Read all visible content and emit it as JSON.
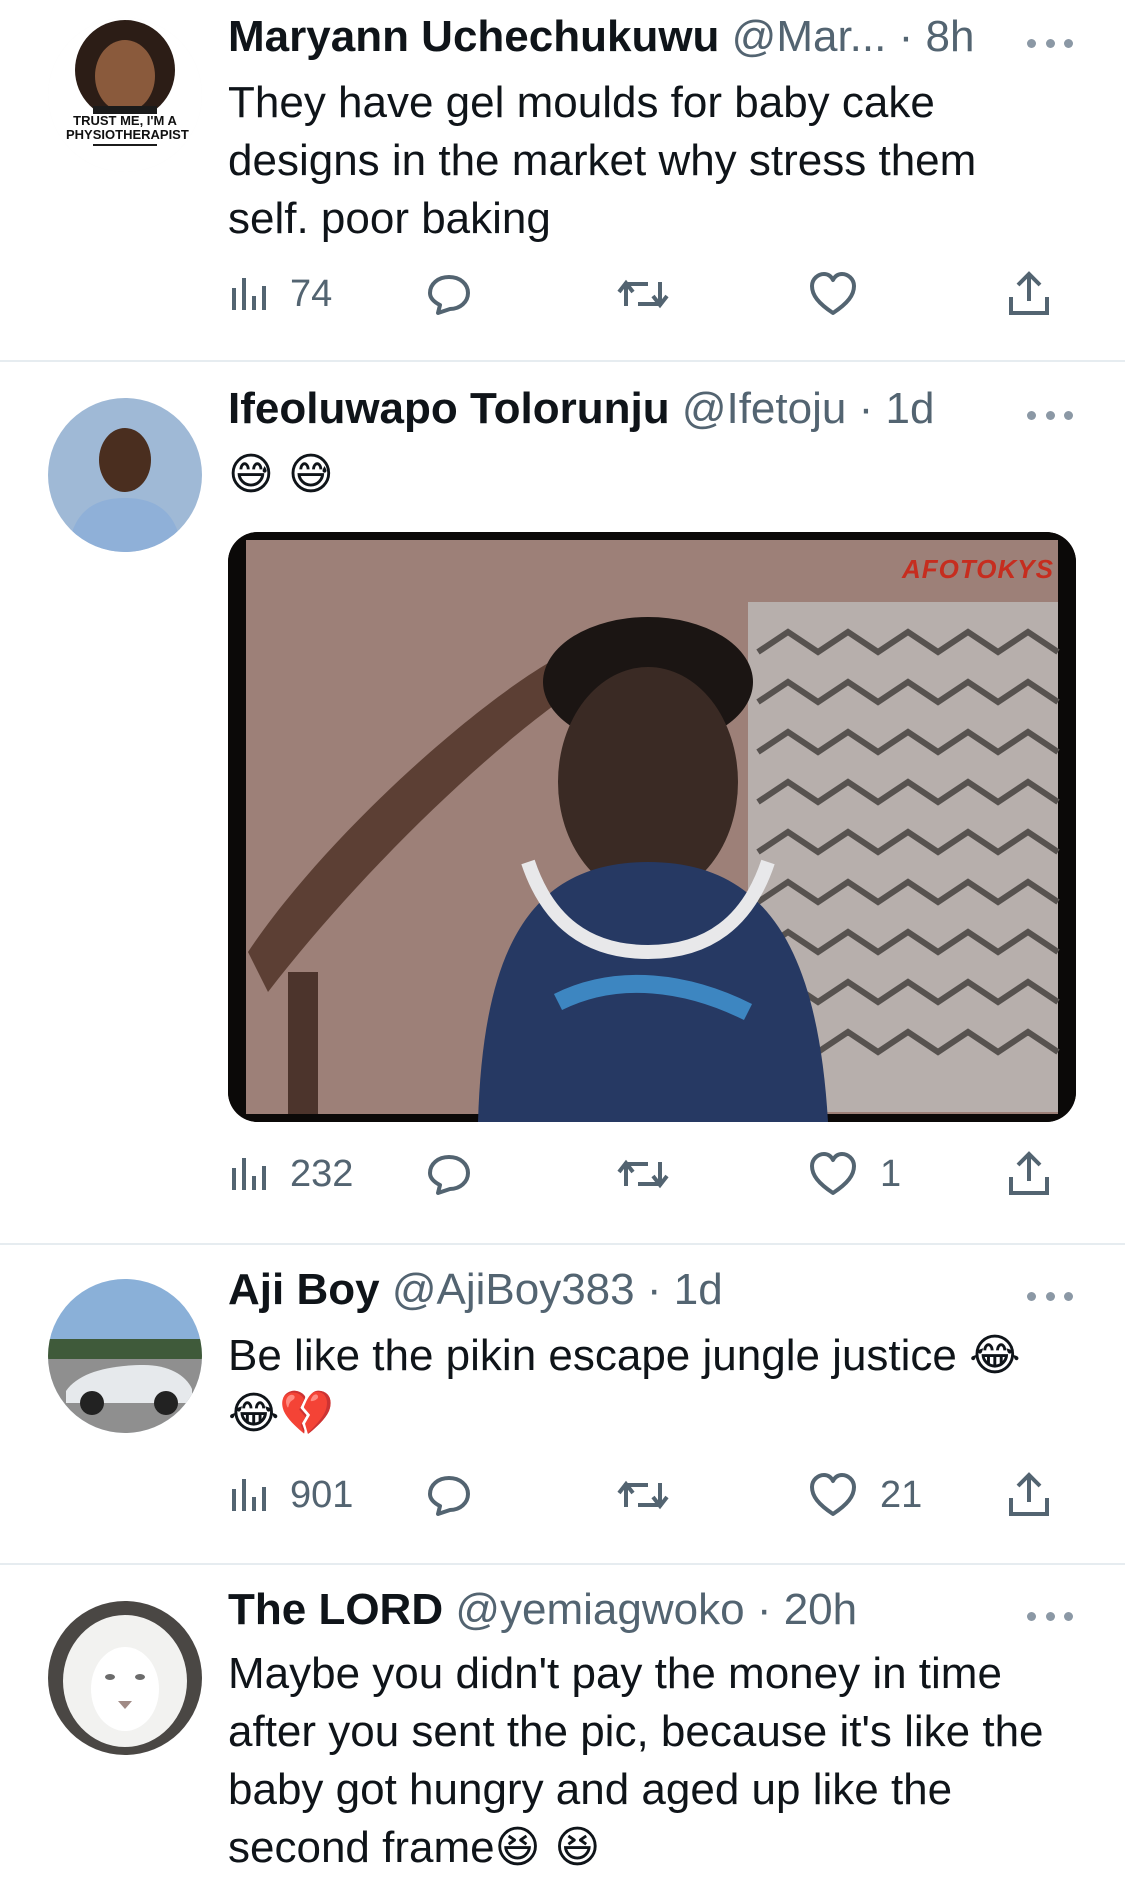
{
  "tweets": [
    {
      "name": "Maryann Uchechukuwu",
      "handle": "@Mar...",
      "time": "8h",
      "text": "They have gel moulds for baby cake designs in the market why stress them self. poor baking",
      "avatar_text": "TRUST ME, I'M A PHYSIOTHERAPIST",
      "stats": {
        "views": "74",
        "replies": "",
        "retweets": "",
        "likes": ""
      }
    },
    {
      "name": "Ifeoluwapo Tolorunju",
      "handle": "@Ifetoju",
      "time": "1d",
      "emojis": "😅 😅",
      "media_watermark": "AFOTOKYS",
      "stats": {
        "views": "232",
        "replies": "",
        "retweets": "",
        "likes": "1"
      }
    },
    {
      "name": "Aji Boy",
      "handle": "@AjiBoy383",
      "time": "1d",
      "text": "Be like the pikin escape jungle justice",
      "emojis": "😂 😂💔",
      "stats": {
        "views": "901",
        "replies": "",
        "retweets": "",
        "likes": "21"
      }
    },
    {
      "name": "The LORD",
      "handle": "@yemiagwoko",
      "time": "20h",
      "text": "Maybe you didn't pay the money in time after you sent the pic, because it's like the baby got hungry and aged up like the second frame",
      "emojis": "😆 😆"
    }
  ],
  "ui": {
    "separator": "·",
    "icons": [
      "views-icon",
      "reply-icon",
      "retweet-icon",
      "like-icon",
      "share-icon",
      "more-icon"
    ],
    "colors": {
      "text": "#0f1419",
      "secondary": "#536471",
      "divider": "#e6ecf0"
    }
  }
}
